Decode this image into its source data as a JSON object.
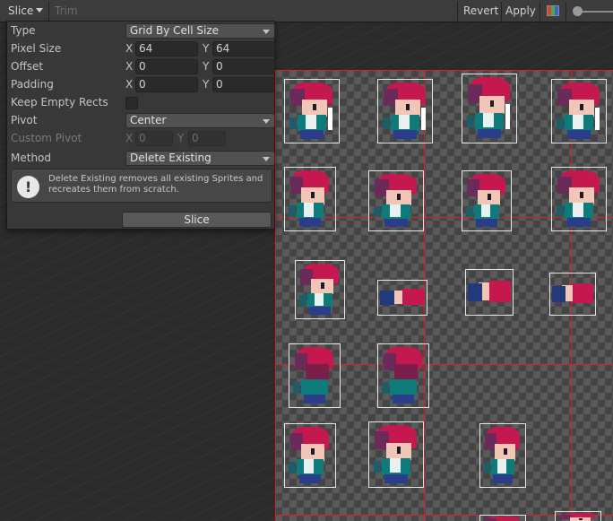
{
  "toolbar": {
    "slice_label": "Slice",
    "trim_label": "Trim",
    "revert_label": "Revert",
    "apply_label": "Apply",
    "color_channels_icon": "rgb-channels-icon",
    "zoom_slider_icon": "slider-knob-icon"
  },
  "panel": {
    "type": {
      "label": "Type",
      "value": "Grid By Cell Size"
    },
    "pixel_size": {
      "label": "Pixel Size",
      "x_axis": "X",
      "x": "64",
      "y_axis": "Y",
      "y": "64"
    },
    "offset": {
      "label": "Offset",
      "x_axis": "X",
      "x": "0",
      "y_axis": "Y",
      "y": "0"
    },
    "padding": {
      "label": "Padding",
      "x_axis": "X",
      "x": "0",
      "y_axis": "Y",
      "y": "0"
    },
    "keep_empty_rects": {
      "label": "Keep Empty Rects",
      "checked": false
    },
    "pivot": {
      "label": "Pivot",
      "value": "Center"
    },
    "custom_pivot": {
      "label": "Custom Pivot",
      "x_axis": "X",
      "x": "0",
      "y_axis": "Y",
      "y": "0"
    },
    "method": {
      "label": "Method",
      "value": "Delete Existing"
    },
    "help": {
      "icon": "exclamation-icon",
      "glyph": "!",
      "text": "Delete Existing removes all existing Sprites and recreates them from scratch."
    },
    "slice_button": "Slice"
  },
  "colors": {
    "grid_lines": "#d71f2e",
    "sprite_outline": "#e6e6e6",
    "panel_bg": "#383838"
  }
}
